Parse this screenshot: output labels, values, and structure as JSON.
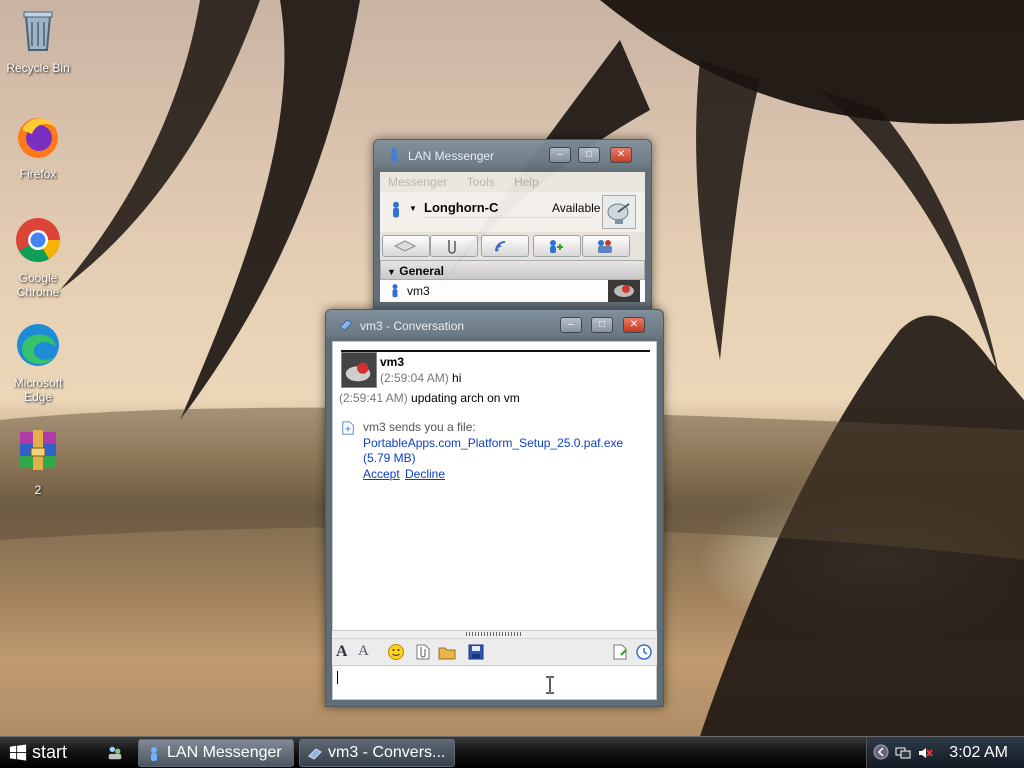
{
  "desktop": {
    "icons": [
      {
        "label": "Recycle Bin"
      },
      {
        "label": "Firefox"
      },
      {
        "label": "Google Chrome"
      },
      {
        "label": "Microsoft Edge"
      },
      {
        "label": "2"
      }
    ]
  },
  "lan_messenger": {
    "title": "LAN Messenger",
    "menu": [
      "Messenger",
      "Tools",
      "Help"
    ],
    "user_name": "Longhorn-C",
    "user_status": "Available",
    "group_name": "General",
    "contact": "vm3"
  },
  "conversation": {
    "title": "vm3 - Conversation",
    "sender": "vm3",
    "messages": [
      {
        "time": "(2:59:04 AM)",
        "text": "hi"
      },
      {
        "time": "(2:59:41 AM)",
        "text": "updating arch on vm"
      }
    ],
    "file_offer": {
      "intro": "vm3 sends you a file:",
      "filename": "PortableApps.com_Platform_Setup_25.0.paf.exe",
      "size": "(5.79 MB)",
      "accept_label": "Accept",
      "decline_label": "Decline"
    }
  },
  "taskbar": {
    "start_label": "start",
    "tasks": [
      {
        "label": "LAN Messenger"
      },
      {
        "label": "vm3 - Convers..."
      }
    ],
    "clock": "3:02 AM"
  },
  "colors": {
    "link": "#0a3fbf",
    "titlebar": "#6c7b86",
    "close_button": "#c53a20"
  }
}
